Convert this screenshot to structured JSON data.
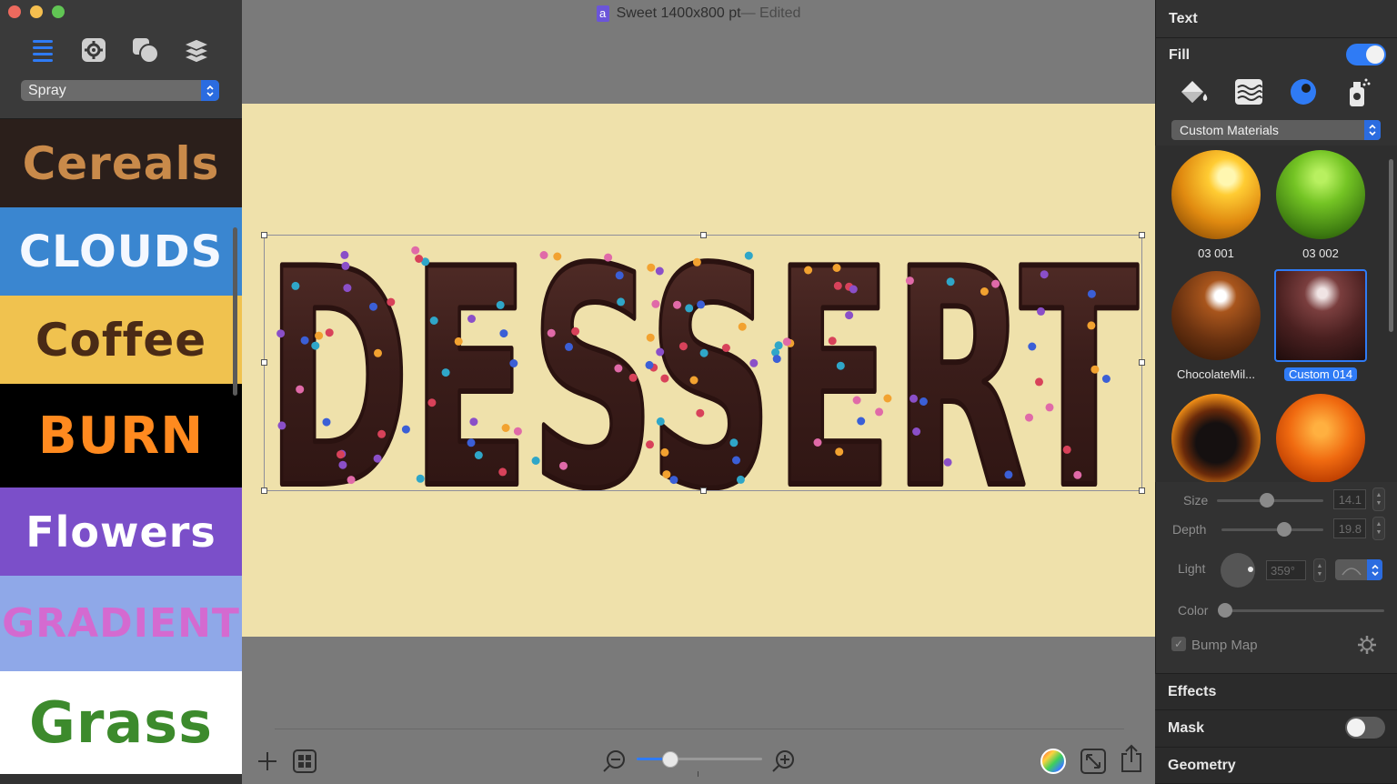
{
  "window": {
    "title": "Sweet 1400x800 pt",
    "status": " — Edited",
    "doc_icon": "a"
  },
  "sidebar": {
    "tabs": [
      {
        "name": "list-icon",
        "active": true
      },
      {
        "name": "gear-icon",
        "active": false
      },
      {
        "name": "shapes-icon",
        "active": false
      },
      {
        "name": "layers-icon",
        "active": false
      }
    ],
    "style_select": "Spray",
    "presets": [
      {
        "label": "Cereals",
        "bg": "#2b1f1b",
        "color": "#c98a4a"
      },
      {
        "label": "CLOUDS",
        "bg": "#3a86d0",
        "color": "#f4f8ff"
      },
      {
        "label": "Coffee",
        "bg": "#f0c24f",
        "color": "#4a2a16"
      },
      {
        "label": "BURN",
        "bg": "#000000",
        "color": "#ff8a1f"
      },
      {
        "label": "Flowers",
        "bg": "#7b4fc9",
        "color": "#ffffff"
      },
      {
        "label": "GRADIENT",
        "bg": "#8fa8e8",
        "color": "#d46ad0"
      },
      {
        "label": "Grass",
        "bg": "#ffffff",
        "color": "#3c8a2c"
      }
    ]
  },
  "canvas": {
    "artwork_text": "DESSERT",
    "artboard_color": "#efe1ab",
    "chocolate_color": "#3a1d1a"
  },
  "bottom_bar": {
    "add_icon": "plus-icon",
    "templates_icon": "templates-icon",
    "zoom_out_icon": "zoom-out-icon",
    "zoom_in_icon": "zoom-in-icon",
    "zoom_level": 0.27,
    "color_icon": "color-wheel-icon",
    "resize_icon": "resize-icon",
    "share_icon": "share-icon"
  },
  "inspector": {
    "section_text": "Text",
    "fill_label": "Fill",
    "fill_enabled": true,
    "fill_types": [
      "paint-bucket-icon",
      "texture-icon",
      "material-icon",
      "spray-icon"
    ],
    "material_select": "Custom Materials",
    "materials": [
      {
        "label": "03 001",
        "selected": false
      },
      {
        "label": "03 002",
        "selected": false
      },
      {
        "label": "ChocolateMil...",
        "selected": false
      },
      {
        "label": "Custom 014",
        "selected": true
      },
      {
        "label": "",
        "selected": false
      },
      {
        "label": "",
        "selected": false
      }
    ],
    "size_label": "Size",
    "size_value": "14.1",
    "depth_label": "Depth",
    "depth_value": "19.8",
    "light_label": "Light",
    "light_value": "359°",
    "color_label": "Color",
    "bump_map_label": "Bump Map",
    "bump_map_checked": true,
    "effects_label": "Effects",
    "mask_label": "Mask",
    "mask_enabled": false,
    "geometry_label": "Geometry",
    "accent": "#2f7bf5"
  }
}
